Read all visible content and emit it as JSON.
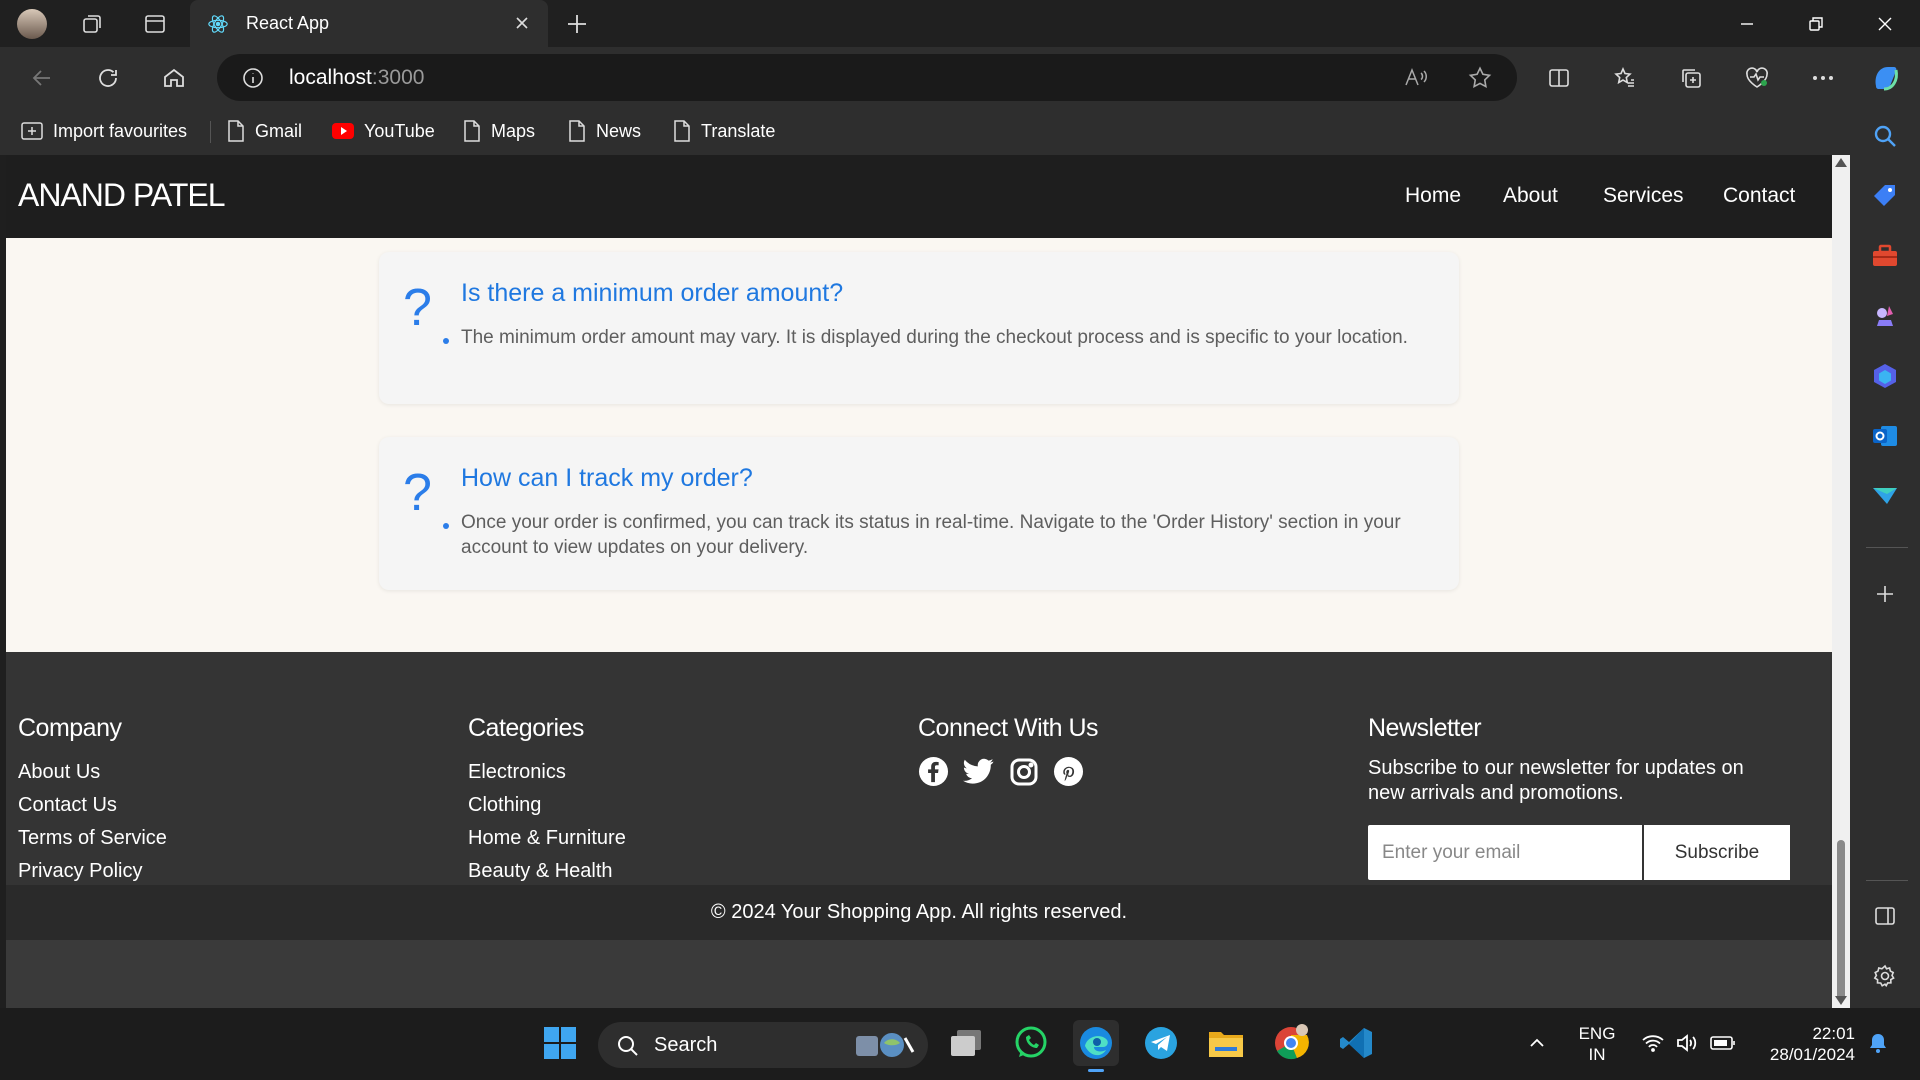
{
  "browser": {
    "tab_title": "React App",
    "url_host": "localhost",
    "url_port": ":3000",
    "bookmarks": [
      "Import favourites",
      "Gmail",
      "YouTube",
      "Maps",
      "News",
      "Translate"
    ]
  },
  "site": {
    "brand": "ANAND PATEL",
    "nav": [
      "Home",
      "About",
      "Services",
      "Contact"
    ]
  },
  "faqs": [
    {
      "question": "Is there a minimum order amount?",
      "answer": "The minimum order amount may vary. It is displayed during the checkout process and is specific to your location."
    },
    {
      "question": "How can I track my order?",
      "answer": "Once your order is confirmed, you can track its status in real-time. Navigate to the 'Order History' section in your account to view updates on your delivery."
    }
  ],
  "footer": {
    "company": {
      "heading": "Company",
      "links": [
        "About Us",
        "Contact Us",
        "Terms of Service",
        "Privacy Policy"
      ]
    },
    "categories": {
      "heading": "Categories",
      "links": [
        "Electronics",
        "Clothing",
        "Home & Furniture",
        "Beauty & Health"
      ]
    },
    "connect": {
      "heading": "Connect With Us",
      "icons": [
        "facebook-icon",
        "twitter-icon",
        "instagram-icon",
        "pinterest-icon"
      ]
    },
    "newsletter": {
      "heading": "Newsletter",
      "text": "Subscribe to our newsletter for updates on new arrivals and promotions.",
      "placeholder": "Enter your email",
      "button": "Subscribe"
    },
    "copyright": "© 2024 Your Shopping App. All rights reserved."
  },
  "taskbar": {
    "search_label": "Search",
    "lang_line1": "ENG",
    "lang_line2": "IN",
    "time": "22:01",
    "date": "28/01/2024"
  },
  "colors": {
    "accent": "#1f78e0",
    "nav_bg": "#1e1e1e",
    "footer_bg": "#343434",
    "page_bg": "#faf7f2"
  }
}
